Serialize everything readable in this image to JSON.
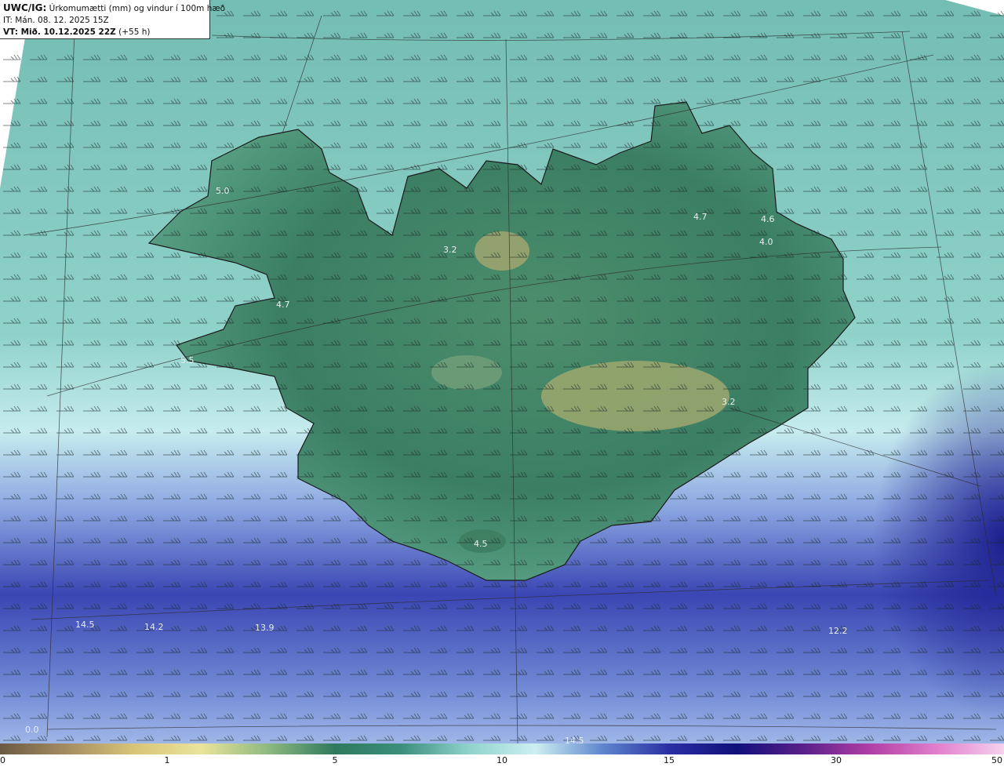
{
  "header": {
    "product": "UWC/IG:",
    "title": "Úrkomumætti (mm) og vindur í 100m hæð",
    "init_time": "IT: Mán. 08. 12. 2025 15Z",
    "valid_label": "VT: Mið. 10.12.2025 22Z",
    "lead_time": "(+55 h)"
  },
  "colorbar": {
    "ticks": [
      {
        "label": "0",
        "value": 0
      },
      {
        "label": "1",
        "value": 1
      },
      {
        "label": "5",
        "value": 5
      },
      {
        "label": "10",
        "value": 10
      },
      {
        "label": "15",
        "value": 15
      },
      {
        "label": "30",
        "value": 30
      },
      {
        "label": "50",
        "value": 50
      }
    ],
    "colors": [
      "#6b5a44",
      "#a58d62",
      "#d8c478",
      "#eae49a",
      "#8fb981",
      "#2f7a5e",
      "#3b8f7c",
      "#8fd2cc",
      "#cdeff0",
      "#5f86cf",
      "#2a2fa3",
      "#10107a",
      "#5a1f8a",
      "#b13fa5",
      "#e27fcd",
      "#f6d2ee"
    ]
  },
  "map": {
    "background_colors": {
      "sea_north": "#78c2b7",
      "land": "#3f8a6e",
      "high_precip": "#2b2f9b"
    },
    "labels": [
      "5.0",
      "4.7",
      "3.2",
      "4.7",
      "4.0",
      "4.6",
      "5.5",
      "3.2",
      "4.5",
      "14.5",
      "14.2",
      "13.9",
      "12.2",
      "14.5",
      "0.0"
    ],
    "wind_barbs": "wind-barb-field"
  }
}
